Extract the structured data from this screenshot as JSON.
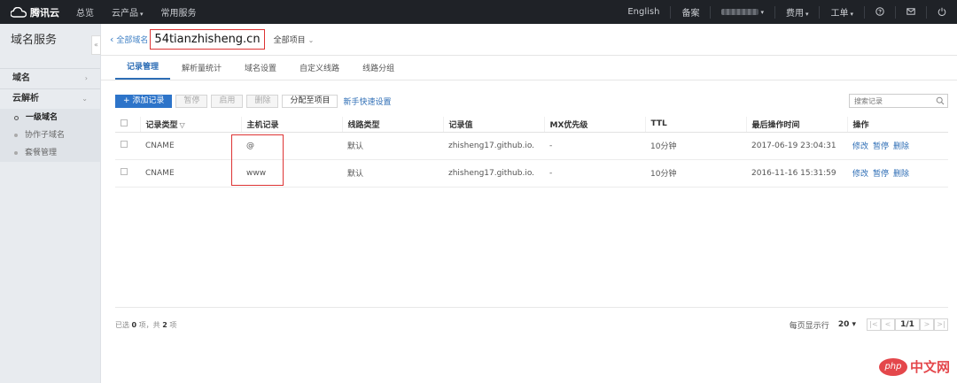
{
  "topnav": {
    "brand": "腾讯云",
    "items": [
      "总览",
      "云产品",
      "常用服务"
    ],
    "right": {
      "lang": "English",
      "beian": "备案",
      "fee": "费用",
      "ticket": "工单"
    }
  },
  "sidebar": {
    "title": "域名服务",
    "collapse": "«",
    "section_domain": "域名",
    "section_dns": "云解析",
    "sub_items": [
      "一级域名",
      "协作子域名",
      "套餐管理"
    ]
  },
  "crumb": {
    "back": "全部域名",
    "domain": "54tianzhisheng.cn",
    "project": "全部项目"
  },
  "tabs": [
    "记录管理",
    "解析量统计",
    "域名设置",
    "自定义线路",
    "线路分组"
  ],
  "toolbar": {
    "add": "+ 添加记录",
    "pause": "暂停",
    "enable": "启用",
    "delete": "删除",
    "assign": "分配至项目",
    "quick": "新手快速设置",
    "search_placeholder": "搜索记录"
  },
  "table": {
    "headers": [
      "记录类型",
      "主机记录",
      "线路类型",
      "记录值",
      "MX优先级",
      "TTL",
      "最后操作时间",
      "操作"
    ],
    "rows": [
      {
        "type": "CNAME",
        "host": "@",
        "line": "默认",
        "value": "zhisheng17.github.io.",
        "mx": "-",
        "ttl": "10分钟",
        "time": "2017-06-19 23:04:31",
        "op_edit": "修改",
        "op_pause": "暂停",
        "op_delete": "删除"
      },
      {
        "type": "CNAME",
        "host": "www",
        "line": "默认",
        "value": "zhisheng17.github.io.",
        "mx": "-",
        "ttl": "10分钟",
        "time": "2016-11-16 15:31:59",
        "op_edit": "修改",
        "op_pause": "暂停",
        "op_delete": "删除"
      }
    ]
  },
  "footer": {
    "summary_pre": "已选",
    "selected": "0",
    "summary_mid": "项，共",
    "total": "2",
    "summary_post": "项",
    "page_size_label": "每页显示行",
    "page_size": "20",
    "page": "1/1"
  },
  "watermark": {
    "logo": "php",
    "text": "中文网"
  },
  "colors": {
    "nav_bg": "#1f2227",
    "primary": "#2d74c9",
    "link": "#2d6db5",
    "highlight": "#d33333"
  }
}
